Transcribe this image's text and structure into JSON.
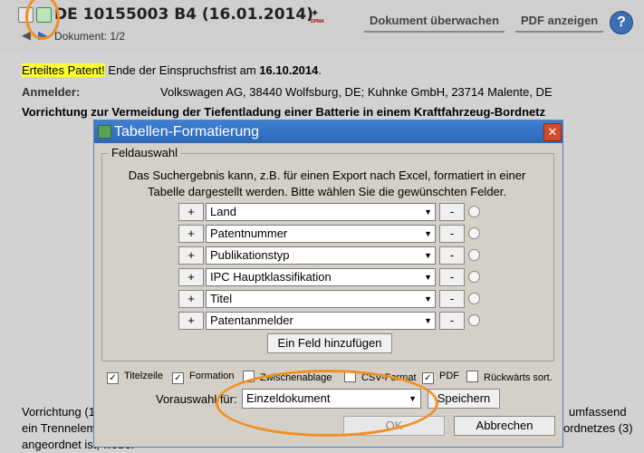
{
  "header": {
    "title": "DE 10155003 B4 (16.01.2014)",
    "dpma": "DPMA",
    "doc_nav": "Dokument: 1/2",
    "btn_watch": "Dokument überwachen",
    "btn_pdf": "PDF anzeigen",
    "help": "?"
  },
  "content": {
    "status_highlight": "Erteiltes Patent!",
    "status_rest": " Ende der Einspruchsfrist am ",
    "status_date": "16.10.2014",
    "status_end": ".",
    "applicant_label": "Anmelder:",
    "applicant_value": "Volkswagen AG, 38440 Wolfsburg, DE; Kuhnke GmbH, 23714 Malente, DE",
    "patent_title": "Vorrichtung zur Vermeidung der Tiefentladung einer Batterie in einem Kraftfahrzeug-Bordnetz",
    "bottom_left_1": "Vorrichtung (1",
    "bottom_left_2": "ein Trennelem",
    "bottom_left_3": "angeordnet ist, wobei",
    "bottom_right_1": "umfassend",
    "bottom_right_2": "ordnetzes (3)"
  },
  "dialog": {
    "title": "Tabellen-Formatierung",
    "close": "✕",
    "legend": "Feldauswahl",
    "description_1": "Das Suchergebnis kann, z.B. für einen Export nach Excel, formatiert in einer",
    "description_2": "Tabelle dargestellt werden. Bitte wählen Sie die gewünschten Felder.",
    "plus": "+",
    "minus": "-",
    "fields": [
      {
        "label": "Land"
      },
      {
        "label": "Patentnummer"
      },
      {
        "label": "Publikationstyp"
      },
      {
        "label": "IPC Hauptklassifikation"
      },
      {
        "label": "Titel"
      },
      {
        "label": "Patentanmelder"
      }
    ],
    "add_field": "Ein Feld hinzufügen",
    "options": [
      {
        "label": "Titelzeile",
        "checked": true
      },
      {
        "label": "Formation",
        "checked": true
      },
      {
        "label": "Zwischenablage",
        "checked": false
      },
      {
        "label": "CSV-Format",
        "checked": false
      },
      {
        "label": "PDF",
        "checked": true
      },
      {
        "label": "Rückwärts sort.",
        "checked": false
      }
    ],
    "preset_label": "Vorauswahl für:",
    "preset_value": "Einzeldokument",
    "save": "Speichern",
    "ok": "OK",
    "cancel": "Abbrechen"
  },
  "colors": {
    "highlight": "#ffff33",
    "annotation_orange": "#f19020",
    "title_bar": "#2c68b8",
    "close_red": "#d64a2a"
  }
}
